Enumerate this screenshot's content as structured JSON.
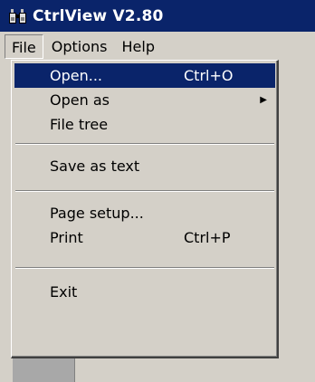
{
  "window": {
    "title": "CtrlView V2.80",
    "icon": "binoculars-icon"
  },
  "menubar": {
    "items": [
      {
        "label": "File",
        "active": true
      },
      {
        "label": "Options"
      },
      {
        "label": "Help"
      }
    ]
  },
  "file_menu": {
    "items": [
      {
        "label": "Open...",
        "shortcut": "Ctrl+O",
        "highlighted": true
      },
      {
        "label": "Open as",
        "submenu": true
      },
      {
        "label": "File tree"
      },
      {
        "label": "Save as text"
      },
      {
        "label": "Page setup..."
      },
      {
        "label": "Print",
        "shortcut": "Ctrl+P"
      },
      {
        "label": "Exit"
      }
    ],
    "submenu_arrow": "▶"
  },
  "colors": {
    "titlebar": "#0a246a",
    "highlight": "#0a246a",
    "face": "#d4d0c8",
    "client": "#a8a8a8"
  }
}
